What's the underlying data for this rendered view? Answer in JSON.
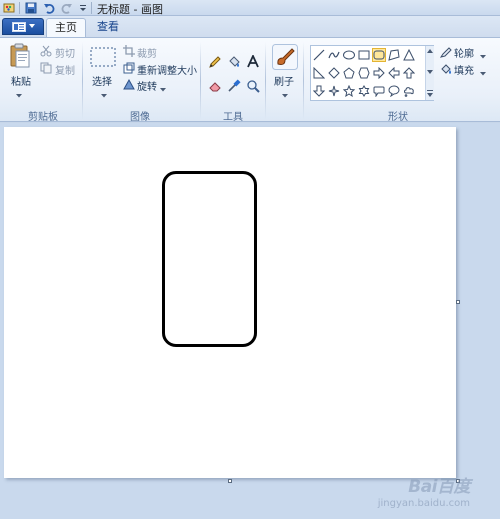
{
  "titlebar": {
    "title": "无标题 - 画图"
  },
  "tabs": [
    {
      "label": "主页",
      "active": true
    },
    {
      "label": "查看",
      "active": false
    }
  ],
  "ribbon": {
    "clipboard": {
      "label": "剪贴板",
      "paste": "粘贴",
      "cut": "剪切",
      "copy": "复制"
    },
    "image": {
      "label": "图像",
      "select": "选择",
      "crop": "裁剪",
      "resize": "重新调整大小",
      "rotate": "旋转"
    },
    "tools": {
      "label": "工具"
    },
    "brushes": {
      "label": "刷子"
    },
    "shapes": {
      "label": "形状",
      "outline": "轮廓",
      "fill": "填充",
      "selected_shape": "rounded-rectangle"
    }
  },
  "canvas": {
    "background": "#ffffff",
    "shape_stroke": "#000000"
  },
  "watermark": {
    "text": "Bai百度",
    "sub": "jingyan.baidu.com"
  },
  "colors": {
    "accent": "#1b4e9f",
    "selected_highlight": "#ffe79b"
  }
}
